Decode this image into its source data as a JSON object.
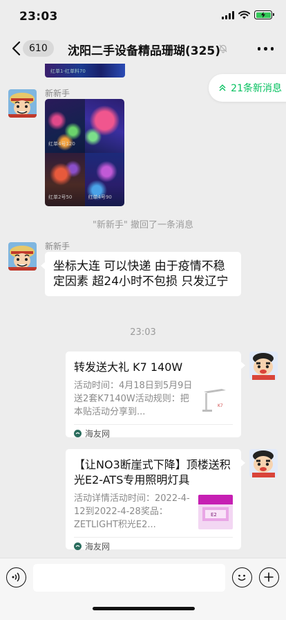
{
  "status_bar": {
    "time": "23:03",
    "battery_color": "#34c759"
  },
  "nav": {
    "unread_count": "610",
    "title": "沈阳二手设备精品珊瑚(325)",
    "icons": [
      "back-chevron-icon",
      "mute-bell-icon",
      "more-icon"
    ]
  },
  "new_messages": {
    "label": "21条新消息",
    "color": "#07c160"
  },
  "top_image": {
    "caption": "红单1-红单料70"
  },
  "messages": [
    {
      "sender": "新新手",
      "type": "image-grid",
      "captions": [
        "红单4号120",
        "",
        "红单2号50",
        "红单4号90"
      ]
    },
    {
      "type": "system",
      "text": "\"新新手\" 撤回了一条消息"
    },
    {
      "sender": "新新手",
      "type": "text",
      "text": "坐标大连  可以快递  由于疫情不稳定因素  超24小时不包损  只发辽宁"
    },
    {
      "type": "time",
      "text": "23:03"
    },
    {
      "type": "link-card",
      "title": "转发送大礼 K7 140W",
      "desc": "活动时间：4月18日到5月9日送2套K7140W活动规则：把本贴活动分享到...",
      "source": "海友网"
    },
    {
      "type": "link-card",
      "title": "【让NO3断崖式下降】顶楼送积光E2-ATS专用照明灯具",
      "desc": "活动详情活动时间：2022-4-12到2022-4-28奖品：ZETLIGHT积光E2...",
      "source": "海友网"
    }
  ],
  "input_bar": {
    "placeholder": "",
    "icons": [
      "voice-icon",
      "emoji-icon",
      "plus-icon"
    ]
  }
}
